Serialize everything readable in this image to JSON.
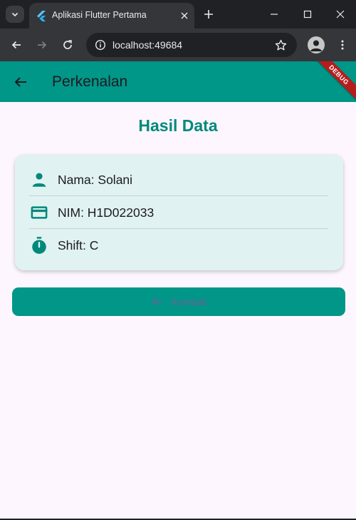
{
  "browser": {
    "tab_title": "Aplikasi Flutter Pertama",
    "url": "localhost:49684",
    "icons": {
      "tab_search": "chevron-down-icon",
      "favicon": "flutter-icon",
      "tab_close": "close-icon",
      "new_tab": "plus-icon",
      "minimize": "minimize-icon",
      "maximize": "maximize-icon",
      "window_close": "close-icon",
      "back": "arrow-left-icon",
      "forward": "arrow-right-icon",
      "reload": "reload-icon",
      "site_info": "info-icon",
      "bookmark": "star-icon",
      "profile": "person-icon",
      "menu": "more-vert-icon"
    }
  },
  "app": {
    "appbar": {
      "title": "Perkenalan",
      "debug_banner": "DEBUG"
    },
    "heading": "Hasil Data",
    "info_rows": [
      {
        "icon": "person-icon",
        "text": "Nama: Solani"
      },
      {
        "icon": "credit-card-icon",
        "text": "NIM: H1D022033"
      },
      {
        "icon": "timer-icon",
        "text": "Shift: C"
      }
    ],
    "back_button": {
      "label": "Kembali",
      "icon": "arrow-left-icon"
    },
    "colors": {
      "primary": "#009688",
      "heading": "#00897b",
      "card_bg": "#e0f2f1",
      "background": "#fdf6fe",
      "button_label": "#7b5b9a"
    }
  }
}
